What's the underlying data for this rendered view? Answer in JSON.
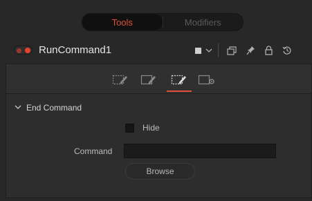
{
  "top_tabs": [
    {
      "label": "Tools",
      "active": true
    },
    {
      "label": "Modifiers",
      "active": false
    }
  ],
  "header": {
    "node_name": "RunCommand1",
    "toggle_color": "#e8412c"
  },
  "accent_color": "#e0503c",
  "inspector_tabs": [
    "controls-tab-1",
    "controls-tab-2",
    "controls-tab-3",
    "settings-tab"
  ],
  "active_inspector_tab": 2,
  "section": {
    "title": "End Command"
  },
  "fields": {
    "hide_label": "Hide",
    "command_label": "Command",
    "command_value": "",
    "browse_label": "Browse"
  }
}
